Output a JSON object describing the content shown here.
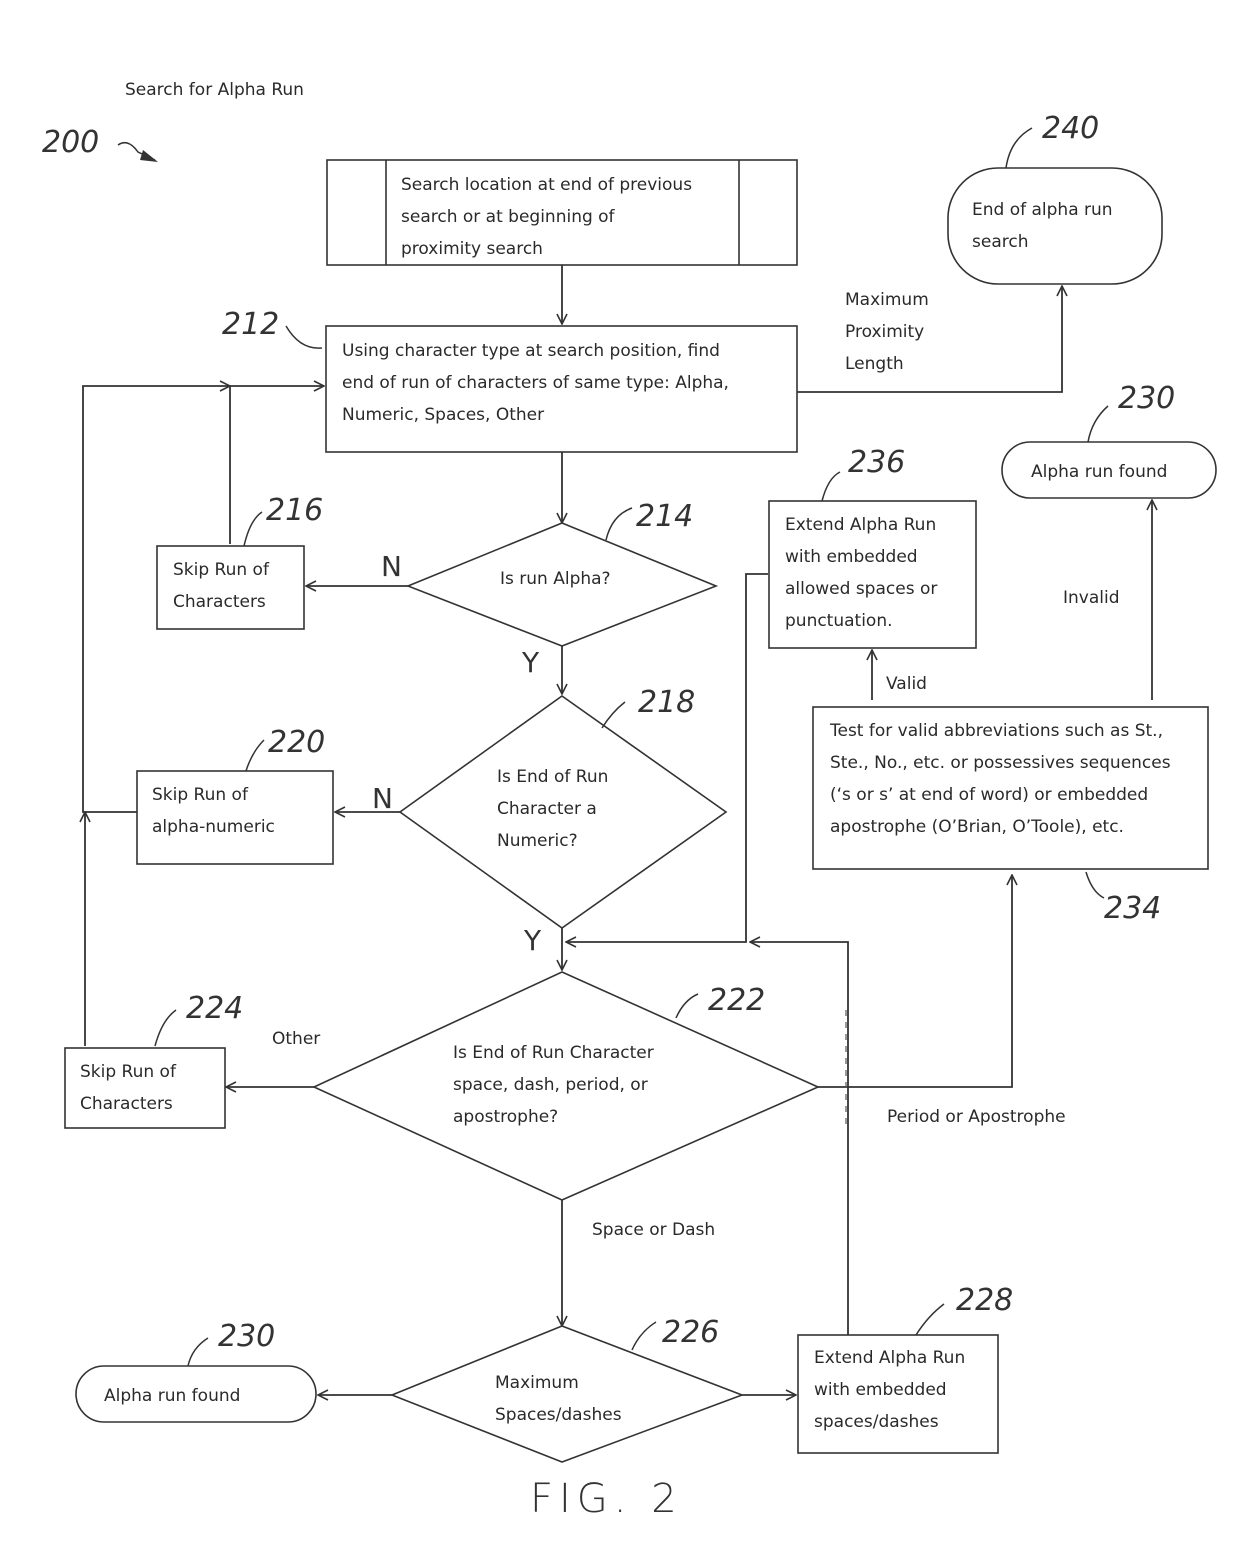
{
  "diagram": {
    "title": "Search for Alpha Run",
    "figure_ref": "200",
    "figure_caption": "FIG. 2",
    "nodes": {
      "start": {
        "ref": "",
        "lines": [
          "Search location at end of previous",
          "search or at beginning of",
          "proximity search"
        ]
      },
      "n212": {
        "ref": "212",
        "lines": [
          "Using character type at search position, find",
          "end of run of characters of same type: Alpha,",
          "Numeric, Spaces, Other"
        ]
      },
      "n214": {
        "ref": "214",
        "lines": [
          "Is run Alpha?"
        ]
      },
      "n216": {
        "ref": "216",
        "lines": [
          "Skip Run of",
          "Characters"
        ]
      },
      "n218": {
        "ref": "218",
        "lines": [
          "Is End of Run",
          "Character a",
          "Numeric?"
        ]
      },
      "n220": {
        "ref": "220",
        "lines": [
          "Skip Run of",
          "alpha-numeric"
        ]
      },
      "n222": {
        "ref": "222",
        "lines": [
          "Is End of Run Character",
          "space, dash, period, or",
          "apostrophe?"
        ]
      },
      "n224": {
        "ref": "224",
        "lines": [
          "Skip Run of",
          "Characters"
        ]
      },
      "n226": {
        "ref": "226",
        "lines": [
          "Maximum",
          "Spaces/dashes"
        ]
      },
      "n228": {
        "ref": "228",
        "lines": [
          "Extend Alpha Run",
          "with embedded",
          "spaces/dashes"
        ]
      },
      "n230a": {
        "ref": "230",
        "lines": [
          "Alpha run found"
        ]
      },
      "n230b": {
        "ref": "230",
        "lines": [
          "Alpha run found"
        ]
      },
      "n234": {
        "ref": "234",
        "lines": [
          "Test for valid abbreviations such as St.,",
          "Ste., No., etc. or possessives sequences",
          "(‘s or s’ at end of word) or embedded",
          "apostrophe (O’Brian, O’Toole), etc."
        ]
      },
      "n236": {
        "ref": "236",
        "lines": [
          "Extend Alpha Run",
          "with embedded",
          "allowed spaces or",
          "punctuation."
        ]
      },
      "n240": {
        "ref": "240",
        "lines": [
          "End of alpha run",
          "search"
        ]
      }
    },
    "edge_labels": {
      "max_proximity": [
        "Maximum",
        "Proximity",
        "Length"
      ],
      "n214_no": "N",
      "n214_yes": "Y",
      "n218_no": "N",
      "n218_yes": "Y",
      "other": "Other",
      "period_apostrophe": "Period or Apostrophe",
      "space_dash": "Space or Dash",
      "valid": "Valid",
      "invalid": "Invalid"
    }
  }
}
